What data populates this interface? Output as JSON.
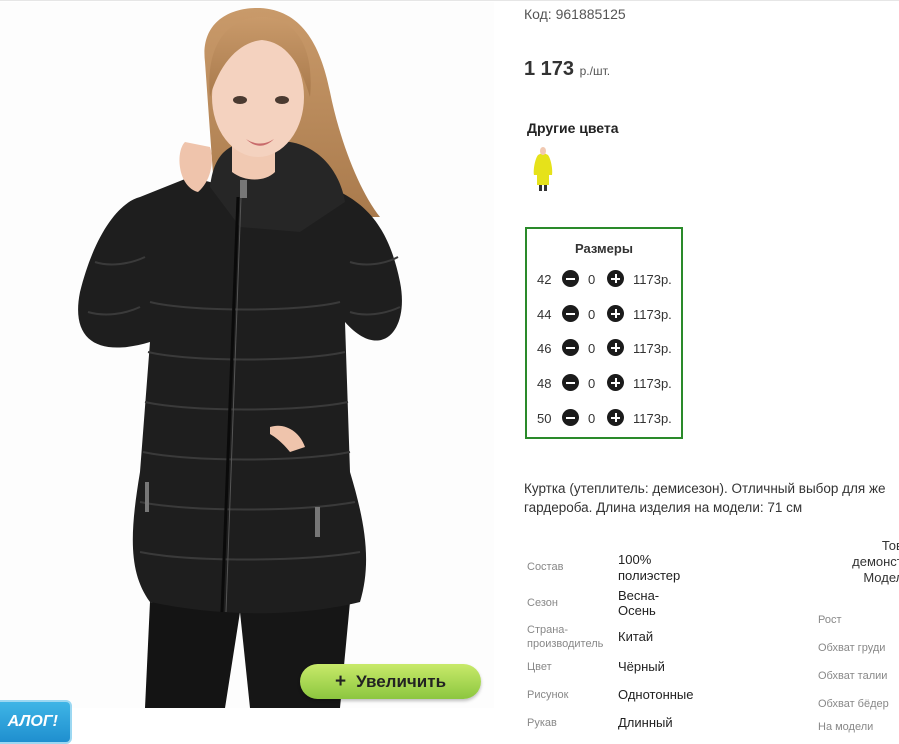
{
  "product": {
    "code": "Код: 961885125",
    "price_value": "1 173",
    "price_unit": "р./шт.",
    "other_colors_title": "Другие цвета",
    "zoom_label": "Увеличить",
    "zoom_plus": "+",
    "catalog_badge": "АЛОГ!"
  },
  "sizes": {
    "title": "Размеры",
    "rows": [
      {
        "size": "42",
        "qty": "0",
        "price": "1173р."
      },
      {
        "size": "44",
        "qty": "0",
        "price": "1173р."
      },
      {
        "size": "46",
        "qty": "0",
        "price": "1173р."
      },
      {
        "size": "48",
        "qty": "0",
        "price": "1173р."
      },
      {
        "size": "50",
        "qty": "0",
        "price": "1173р."
      }
    ]
  },
  "description": {
    "line1": "Куртка (утеплитель: демисезон). Отличный выбор для же",
    "line2": "гардероба. Длина изделия на модели: 71 см"
  },
  "properties": {
    "composition_label": "Состав",
    "composition_value_1": "100%",
    "composition_value_2": "полиэстер",
    "season_label": "Сезон",
    "season_value_1": "Весна-",
    "season_value_2": "Осень",
    "country_label_1": "Страна-",
    "country_label_2": "производитель",
    "country_value": "Китай",
    "color_label": "Цвет",
    "color_value": "Чёрный",
    "pattern_label": "Рисунок",
    "pattern_value": "Однотонные",
    "sleeve_label": "Рукав",
    "sleeve_value": "Длинный"
  },
  "model": {
    "head_1": "Това",
    "head_2": "демонстр",
    "head_3": "Модель",
    "height_label": "Рост",
    "chest_label": "Обхват груди",
    "waist_label": "Обхват талии",
    "hips_label": "Обхват бёдер",
    "on_model_label": "На модели"
  },
  "colors": {
    "size_box_border": "#2a8a2a",
    "zoom_button": "#8cc63f",
    "catalog_badge": "#1f8fcf",
    "jacket": "#1e1e1e",
    "alt_color_swatch": "#e6e21a"
  }
}
